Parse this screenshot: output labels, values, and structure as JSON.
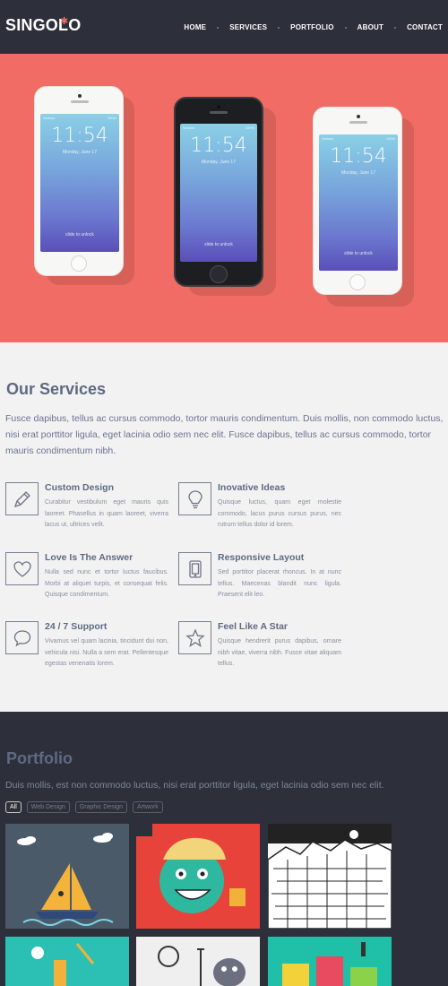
{
  "header": {
    "logo": "SINGOLO",
    "nav": [
      "HOME",
      "SERVICES",
      "PORTFOLIO",
      "ABOUT",
      "CONTACT"
    ]
  },
  "hero": {
    "phones": [
      {
        "time": "11:54",
        "date": "Monday, June 17",
        "unlock": "slide to unlock",
        "carrier": "Verizon",
        "battery": "100%"
      },
      {
        "time": "11:54",
        "date": "Monday, June 17",
        "unlock": "slide to unlock",
        "carrier": "Verizon",
        "battery": "100%"
      },
      {
        "time": "11:54",
        "date": "Monday, June 17",
        "unlock": "slide to unlock",
        "carrier": "Verizon",
        "battery": "100%"
      }
    ]
  },
  "services": {
    "title": "Our Services",
    "intro": "Fusce dapibus, tellus ac cursus commodo, tortor mauris condimentum. Duis mollis, non commodo luctus, nisi erat porttitor ligula, eget lacinia odio sem nec elit. Fusce dapibus, tellus ac cursus commodo, tortor mauris condimentum nibh.",
    "items": [
      {
        "icon": "pencil-icon",
        "title": "Custom Design",
        "desc": "Curabitur vestibulum eget mauris quis laoreet. Phasellus in quam laoreet, viverra lacus ut, ultrices velit."
      },
      {
        "icon": "bulb-icon",
        "title": "Inovative Ideas",
        "desc": "Quisque luctus, quam eget molestie commodo, lacus purus cursus purus, nec rutrum tellus dolor id lorem."
      },
      {
        "icon": "heart-icon",
        "title": "Love Is The Answer",
        "desc": "Nulla sed nunc et tortor luctus faucibus. Morbi at aliquet turpis, et consequat felis. Quisque condimentum."
      },
      {
        "icon": "tablet-icon",
        "title": "Responsive Layout",
        "desc": "Sed porttitor placerat rhoncus. In at nunc tellus. Maecenas blandit nunc ligula. Praesent elit leo."
      },
      {
        "icon": "chat-icon",
        "title": "24 / 7 Support",
        "desc": "Vivamus vel quam lacinia, tincidunt dui non, vehicula nisi. Nulla a sem erat. Pellentesque egestas venenatis lorem."
      },
      {
        "icon": "star-icon",
        "title": "Feel Like A Star",
        "desc": "Quisque hendrerit purus dapibus, ornare nibh vitae, viverra nibh. Fusce vitae aliquam tellus."
      }
    ]
  },
  "portfolio": {
    "title": "Portfolio",
    "intro": "Duis mollis, est non commodo luctus, nisi erat porttitor ligula, eget lacinia odio sem nec elit.",
    "filters": [
      "All",
      "Web Design",
      "Graphic Design",
      "Artwork"
    ],
    "active_filter": "All"
  },
  "colors": {
    "accent": "#f06c64",
    "dark": "#2d303a",
    "light": "#f2f2f2",
    "heading": "#5e6a81"
  }
}
